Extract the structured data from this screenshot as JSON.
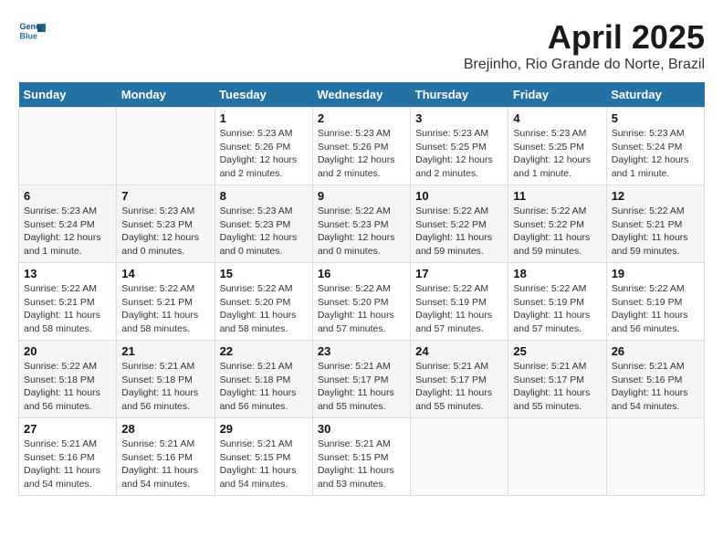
{
  "header": {
    "logo_line1": "General",
    "logo_line2": "Blue",
    "month": "April 2025",
    "location": "Brejinho, Rio Grande do Norte, Brazil"
  },
  "weekdays": [
    "Sunday",
    "Monday",
    "Tuesday",
    "Wednesday",
    "Thursday",
    "Friday",
    "Saturday"
  ],
  "weeks": [
    [
      {
        "day": "",
        "info": ""
      },
      {
        "day": "",
        "info": ""
      },
      {
        "day": "1",
        "info": "Sunrise: 5:23 AM\nSunset: 5:26 PM\nDaylight: 12 hours and 2 minutes."
      },
      {
        "day": "2",
        "info": "Sunrise: 5:23 AM\nSunset: 5:26 PM\nDaylight: 12 hours and 2 minutes."
      },
      {
        "day": "3",
        "info": "Sunrise: 5:23 AM\nSunset: 5:25 PM\nDaylight: 12 hours and 2 minutes."
      },
      {
        "day": "4",
        "info": "Sunrise: 5:23 AM\nSunset: 5:25 PM\nDaylight: 12 hours and 1 minute."
      },
      {
        "day": "5",
        "info": "Sunrise: 5:23 AM\nSunset: 5:24 PM\nDaylight: 12 hours and 1 minute."
      }
    ],
    [
      {
        "day": "6",
        "info": "Sunrise: 5:23 AM\nSunset: 5:24 PM\nDaylight: 12 hours and 1 minute."
      },
      {
        "day": "7",
        "info": "Sunrise: 5:23 AM\nSunset: 5:23 PM\nDaylight: 12 hours and 0 minutes."
      },
      {
        "day": "8",
        "info": "Sunrise: 5:23 AM\nSunset: 5:23 PM\nDaylight: 12 hours and 0 minutes."
      },
      {
        "day": "9",
        "info": "Sunrise: 5:22 AM\nSunset: 5:23 PM\nDaylight: 12 hours and 0 minutes."
      },
      {
        "day": "10",
        "info": "Sunrise: 5:22 AM\nSunset: 5:22 PM\nDaylight: 11 hours and 59 minutes."
      },
      {
        "day": "11",
        "info": "Sunrise: 5:22 AM\nSunset: 5:22 PM\nDaylight: 11 hours and 59 minutes."
      },
      {
        "day": "12",
        "info": "Sunrise: 5:22 AM\nSunset: 5:21 PM\nDaylight: 11 hours and 59 minutes."
      }
    ],
    [
      {
        "day": "13",
        "info": "Sunrise: 5:22 AM\nSunset: 5:21 PM\nDaylight: 11 hours and 58 minutes."
      },
      {
        "day": "14",
        "info": "Sunrise: 5:22 AM\nSunset: 5:21 PM\nDaylight: 11 hours and 58 minutes."
      },
      {
        "day": "15",
        "info": "Sunrise: 5:22 AM\nSunset: 5:20 PM\nDaylight: 11 hours and 58 minutes."
      },
      {
        "day": "16",
        "info": "Sunrise: 5:22 AM\nSunset: 5:20 PM\nDaylight: 11 hours and 57 minutes."
      },
      {
        "day": "17",
        "info": "Sunrise: 5:22 AM\nSunset: 5:19 PM\nDaylight: 11 hours and 57 minutes."
      },
      {
        "day": "18",
        "info": "Sunrise: 5:22 AM\nSunset: 5:19 PM\nDaylight: 11 hours and 57 minutes."
      },
      {
        "day": "19",
        "info": "Sunrise: 5:22 AM\nSunset: 5:19 PM\nDaylight: 11 hours and 56 minutes."
      }
    ],
    [
      {
        "day": "20",
        "info": "Sunrise: 5:22 AM\nSunset: 5:18 PM\nDaylight: 11 hours and 56 minutes."
      },
      {
        "day": "21",
        "info": "Sunrise: 5:21 AM\nSunset: 5:18 PM\nDaylight: 11 hours and 56 minutes."
      },
      {
        "day": "22",
        "info": "Sunrise: 5:21 AM\nSunset: 5:18 PM\nDaylight: 11 hours and 56 minutes."
      },
      {
        "day": "23",
        "info": "Sunrise: 5:21 AM\nSunset: 5:17 PM\nDaylight: 11 hours and 55 minutes."
      },
      {
        "day": "24",
        "info": "Sunrise: 5:21 AM\nSunset: 5:17 PM\nDaylight: 11 hours and 55 minutes."
      },
      {
        "day": "25",
        "info": "Sunrise: 5:21 AM\nSunset: 5:17 PM\nDaylight: 11 hours and 55 minutes."
      },
      {
        "day": "26",
        "info": "Sunrise: 5:21 AM\nSunset: 5:16 PM\nDaylight: 11 hours and 54 minutes."
      }
    ],
    [
      {
        "day": "27",
        "info": "Sunrise: 5:21 AM\nSunset: 5:16 PM\nDaylight: 11 hours and 54 minutes."
      },
      {
        "day": "28",
        "info": "Sunrise: 5:21 AM\nSunset: 5:16 PM\nDaylight: 11 hours and 54 minutes."
      },
      {
        "day": "29",
        "info": "Sunrise: 5:21 AM\nSunset: 5:15 PM\nDaylight: 11 hours and 54 minutes."
      },
      {
        "day": "30",
        "info": "Sunrise: 5:21 AM\nSunset: 5:15 PM\nDaylight: 11 hours and 53 minutes."
      },
      {
        "day": "",
        "info": ""
      },
      {
        "day": "",
        "info": ""
      },
      {
        "day": "",
        "info": ""
      }
    ]
  ]
}
